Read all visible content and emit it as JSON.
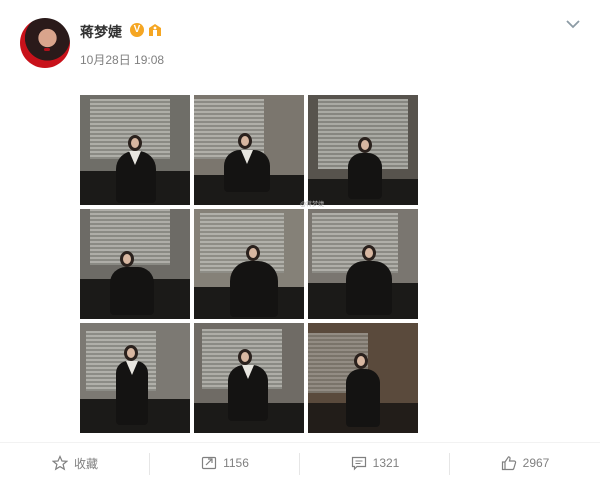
{
  "post": {
    "author": "蒋梦婕",
    "verified_badge": "V",
    "time": "10月28日 19:08",
    "watermark": "@蒋梦婕",
    "image_count": 9
  },
  "icons": {
    "avatar": "avatar",
    "verified": "verified-badge-icon",
    "medal": "member-medal-icon",
    "menu": "chevron-down-icon"
  },
  "actions": {
    "favorite_label": "收藏",
    "repost_count": "1156",
    "comment_count": "1321",
    "like_count": "2967"
  },
  "colors": {
    "accent_orange": "#f5a623",
    "text_primary": "#333333",
    "text_secondary": "#808080"
  }
}
